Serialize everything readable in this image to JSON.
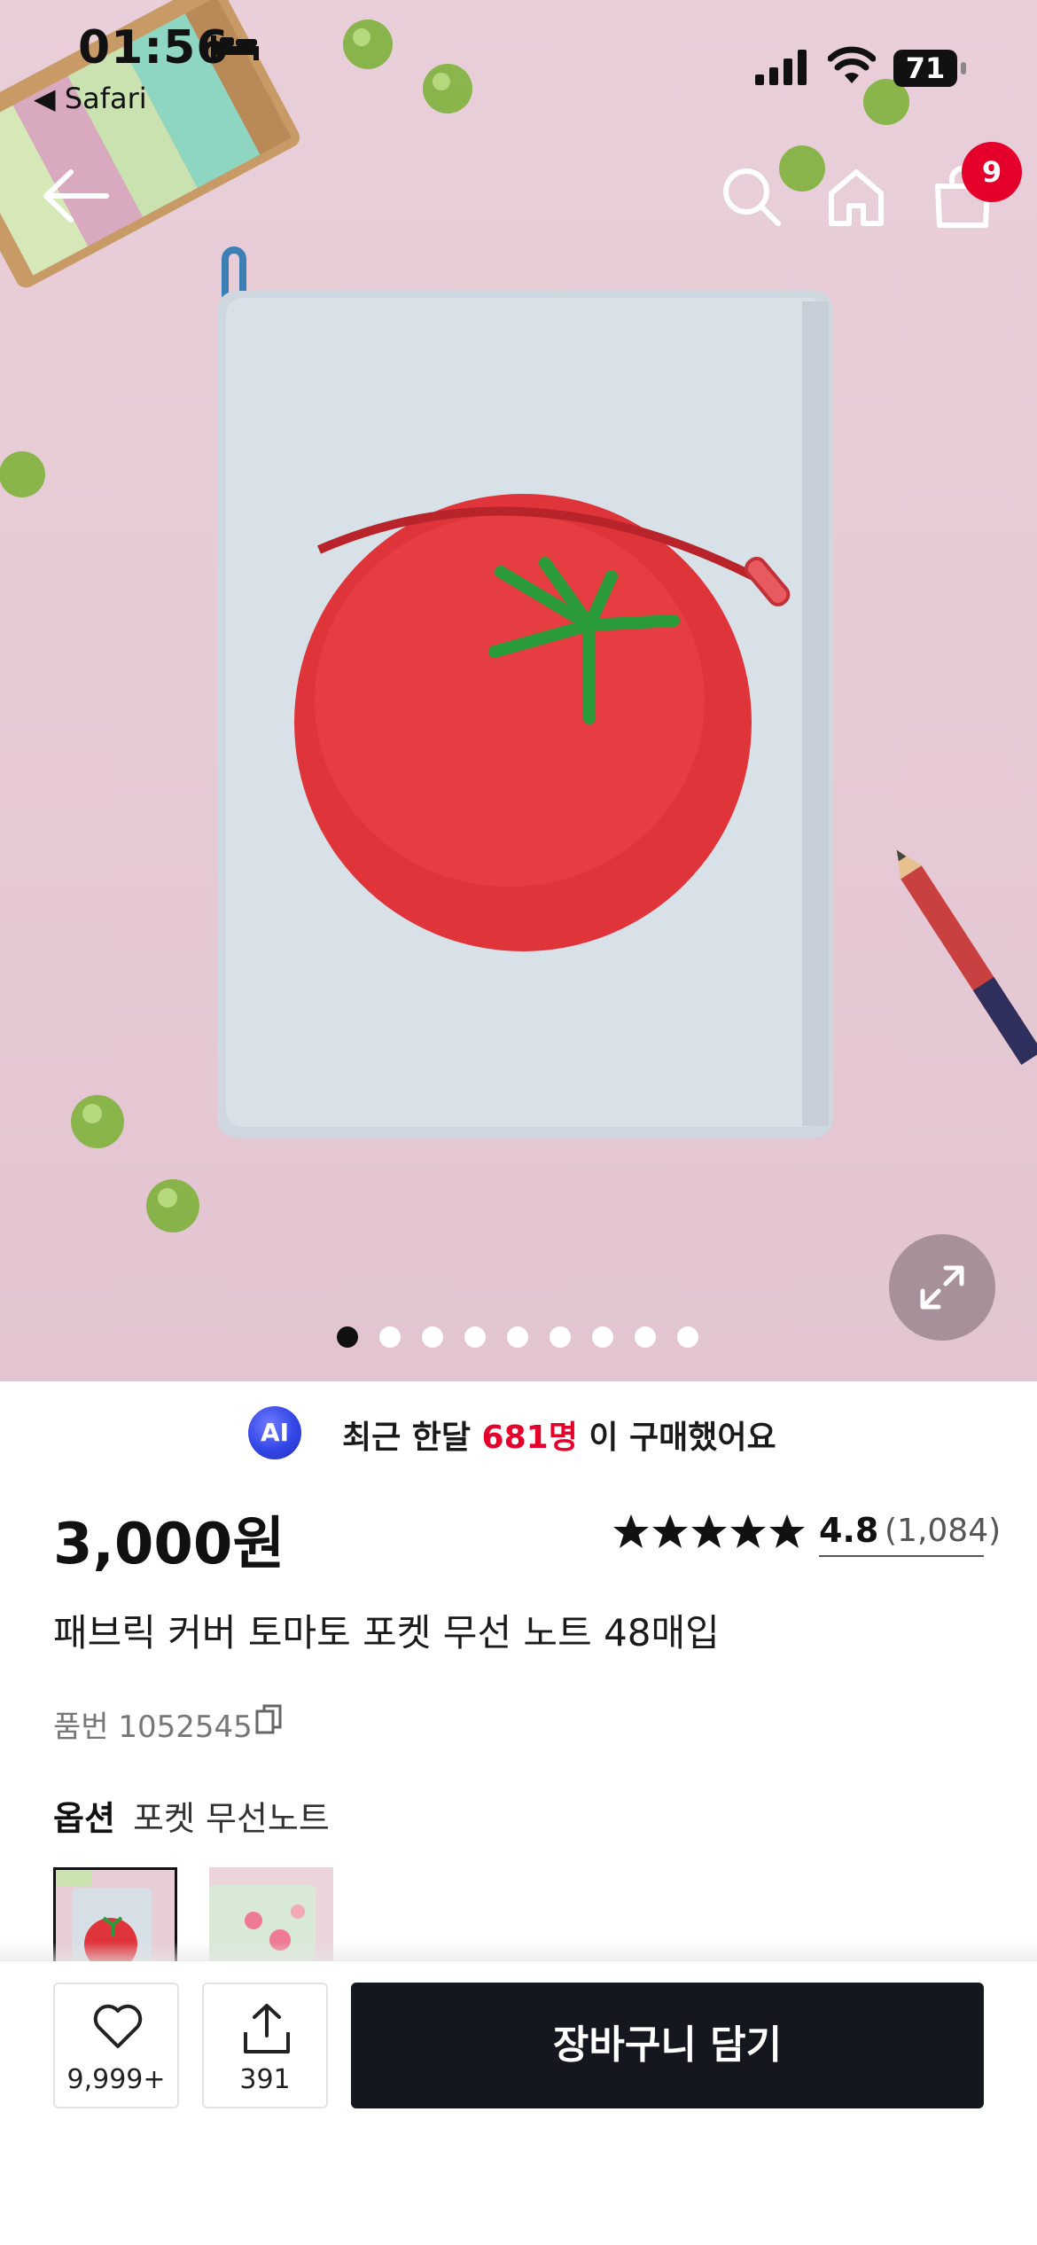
{
  "status_bar": {
    "time": "01:56",
    "back_app": "◀ Safari",
    "battery": "71",
    "icons": [
      "bed-icon",
      "signal-icon",
      "wifi-icon",
      "battery-icon"
    ]
  },
  "nav": {
    "cart_badge": "9",
    "icons": [
      "back-arrow-icon",
      "search-icon",
      "home-icon",
      "cart-icon"
    ]
  },
  "gallery": {
    "image_count": 9,
    "active_index": 0,
    "expand_icon": "expand-icon"
  },
  "ai_banner": {
    "badge": "AI",
    "prefix": "최근 한달 ",
    "highlight": "681명",
    "suffix": " 이 구매했어요",
    "highlight_color": "#e4002b"
  },
  "product": {
    "price": "3,000원",
    "rating": "4.8",
    "review_count": "(1,084)",
    "star_count": 5,
    "title": "패브릭 커버 토마토 포켓 무선 노트 48매입",
    "sku": "품번 1052545"
  },
  "options": {
    "label": "옵션",
    "selected_value": "포켓 무선노트"
  },
  "bottom_bar": {
    "like_count": "9,999+",
    "share_count": "391",
    "cart_button": "장바구니 담기",
    "cart_button_color": "#14171d"
  }
}
